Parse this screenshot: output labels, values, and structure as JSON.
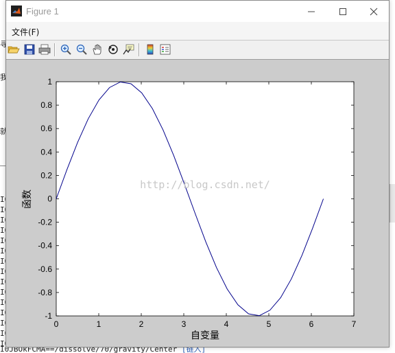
{
  "window": {
    "title": "Figure 1",
    "minimize_glyph": "—",
    "maximize_glyph": "☐",
    "close_glyph": "✕"
  },
  "menu": {
    "items": [
      {
        "label": "文件(F)"
      }
    ]
  },
  "toolbar": {
    "buttons": [
      {
        "icon": "open-folder-icon"
      },
      {
        "icon": "save-icon"
      },
      {
        "icon": "print-icon"
      },
      {
        "icon": "zoom-in-icon"
      },
      {
        "icon": "zoom-out-icon"
      },
      {
        "icon": "pan-hand-icon"
      },
      {
        "icon": "rotate-3d-icon"
      },
      {
        "icon": "data-cursor-icon"
      },
      {
        "icon": "colorbar-icon"
      },
      {
        "icon": "legend-icon"
      }
    ]
  },
  "background": {
    "left_chars": [
      "I0",
      "I0",
      "I0",
      "I0",
      "I0",
      "I0",
      "I0",
      "I0",
      "I0",
      "I0",
      "I0",
      "I0",
      "I0",
      "I0",
      "I0"
    ],
    "bottom_text": "I0JBOkFCMA==/dissolve/70/gravity/Center",
    "bottom_link": "[链入]"
  },
  "watermark": "http://blog.csdn.net/",
  "chart_data": {
    "type": "line",
    "xlabel": "自变量",
    "ylabel": "函数",
    "xlim": [
      0,
      7
    ],
    "ylim": [
      -1,
      1
    ],
    "xticks": [
      "0",
      "1",
      "2",
      "3",
      "4",
      "5",
      "6",
      "7"
    ],
    "yticks": [
      "-1",
      "-0.8",
      "-0.6",
      "-0.4",
      "-0.2",
      "0",
      "0.2",
      "0.4",
      "0.6",
      "0.8",
      "1"
    ],
    "series": [
      {
        "color": "#00008b",
        "x": [
          0,
          0.2513,
          0.5027,
          0.754,
          1.0053,
          1.2566,
          1.508,
          1.7593,
          2.0106,
          2.2619,
          2.5133,
          2.7646,
          3.0159,
          3.2673,
          3.5186,
          3.7699,
          4.0212,
          4.2726,
          4.5239,
          4.7752,
          5.0265,
          5.2779,
          5.5292,
          5.7805,
          6.0319,
          6.2832
        ],
        "y": [
          0,
          0.2487,
          0.4818,
          0.6845,
          0.8443,
          0.9511,
          0.998,
          0.9823,
          0.9048,
          0.7705,
          0.5878,
          0.3681,
          0.1253,
          -0.1253,
          -0.3681,
          -0.5878,
          -0.7705,
          -0.9048,
          -0.9823,
          -0.998,
          -0.9511,
          -0.8443,
          -0.6845,
          -0.4818,
          -0.2487,
          0
        ]
      }
    ]
  },
  "colors": {
    "figure_bg": "#cccccc",
    "axes_bg": "#ffffff",
    "line": "#00008b",
    "watermark": "#c8c8c8"
  }
}
